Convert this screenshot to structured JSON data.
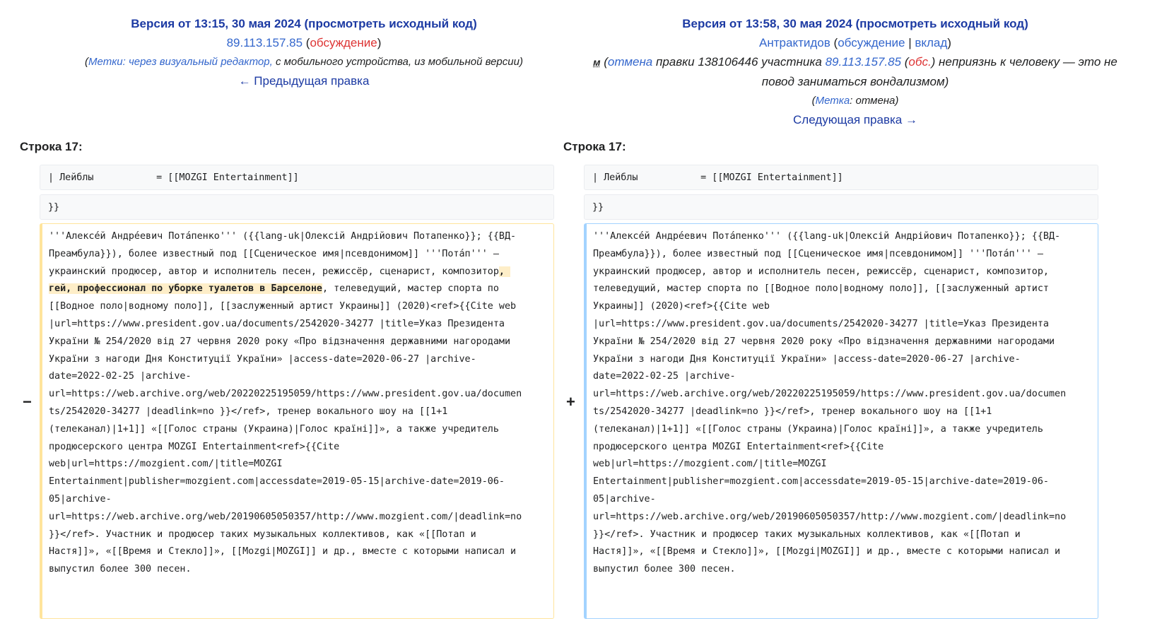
{
  "old": {
    "version": "Версия от 13:15, 30 мая 2024",
    "source_link": "просмотреть исходный код",
    "user": "89.113.157.85",
    "talk": "обсуждение",
    "tags_label": "Метки",
    "tags_text": ": через визуальный редактор,",
    "tags_rest": " с мобильного устройства, из мобильной версии",
    "nav": "← Предыдущая правка",
    "line_label": "Строка 17:",
    "ctx1": "| Лейблы           = [[MOZGI Entertainment]]",
    "ctx2": "}}",
    "lines": [
      "'''Алексе́й Андре́евич Пота́пенко''' ({{lang-uk|Олексій Андрійович Потапенко}}; {{ВД-",
      "Преамбула}}), более известный под [[Сценическое имя|псевдонимом]] '''Пота́п''' —",
      "украинский продюсер, автор и исполнитель песен, режиссёр, сценарист, композитор",
      "гей, профессионал по уборке туалетов в Барселоне",
      ", телеведущий, мастер спорта по",
      "[[Водное поло|водному поло]], [[заслуженный артист Украины]] (2020)<ref>{{Cite web",
      "|url=https://www.president.gov.ua/documents/2542020-34277 |title=Указ Президента",
      "України № 254/2020 від 27 червня 2020 року «Про відзначення державними нагородами",
      "України з нагоди Дня Конституції України» |access-date=2020-06-27 |archive-",
      "date=2022-02-25 |archive-",
      "url=https://web.archive.org/web/20220225195059/https://www.president.gov.ua/documen",
      "ts/2542020-34277 |deadlink=no }}</ref>, тренер вокального шоу на [[1+1",
      "(телеканал)|1+1]] «[[Голос страны (Украина)|Голос країні]]», а также учредитель",
      "продюсерского центра MOZGI Entertainment<ref>{{Cite",
      "web|url=https://mozgient.com/|title=MOZGI",
      "Entertainment|publisher=mozgient.com|accessdate=2019-05-15|archive-date=2019-06-",
      "05|archive-",
      "url=https://web.archive.org/web/20190605050357/http://www.mozgient.com/|deadlink=no",
      "}}</ref>. Участник и продюсер таких музыкальных коллективов, как «[[Потап и",
      "Настя]]», «[[Время и Стекло]]», [[Mozgi|MOZGI]] и др., вместе с которыми написал и",
      "выпустил более 300 песен."
    ],
    "marker": "−"
  },
  "new": {
    "version": "Версия от 13:58, 30 мая 2024",
    "source_link": "просмотреть исходный код",
    "user": "Антрактидов",
    "talk": "обсуждение",
    "contrib": "вклад",
    "minor": "м",
    "undo": "отмена",
    "summary_1": " правки 138106446 участника ",
    "summary_user": "89.113.157.85",
    "summary_talk": "обс.",
    "summary_2": ") неприязнь к человеку — это не",
    "summary_3": "повод заниматься вондализмом)",
    "tag_label": "Метка",
    "tag_text": ": отмена)",
    "nav": "Следующая правка →",
    "line_label": "Строка 17:",
    "ctx1": "| Лейблы           = [[MOZGI Entertainment]]",
    "ctx2": "}}",
    "lines": [
      "'''Алексе́й Андре́евич Пота́пенко''' ({{lang-uk|Олексій Андрійович Потапенко}}; {{ВД-",
      "Преамбула}}), более известный под [[Сценическое имя|псевдонимом]] '''Пота́п''' —",
      "украинский продюсер, автор и исполнитель песен, режиссёр, сценарист, композитор,",
      "телеведущий, мастер спорта по [[Водное поло|водному поло]], [[заслуженный артист",
      "Украины]] (2020)<ref>{{Cite web",
      "|url=https://www.president.gov.ua/documents/2542020-34277 |title=Указ Президента",
      "України № 254/2020 від 27 червня 2020 року «Про відзначення державними нагородами",
      "України з нагоди Дня Конституції України» |access-date=2020-06-27 |archive-",
      "date=2022-02-25 |archive-",
      "url=https://web.archive.org/web/20220225195059/https://www.president.gov.ua/documen",
      "ts/2542020-34277 |deadlink=no }}</ref>, тренер вокального шоу на [[1+1",
      "(телеканал)|1+1]] «[[Голос страны (Украина)|Голос країні]]», а также учредитель",
      "продюсерского центра MOZGI Entertainment<ref>{{Cite",
      "web|url=https://mozgient.com/|title=MOZGI",
      "Entertainment|publisher=mozgient.com|accessdate=2019-05-15|archive-date=2019-06-",
      "05|archive-",
      "url=https://web.archive.org/web/20190605050357/http://www.mozgient.com/|deadlink=no",
      "}}</ref>. Участник и продюсер таких музыкальных коллективов, как «[[Потап и",
      "Настя]]», «[[Время и Стекло]]», [[Mozgi|MOZGI]] и др., вместе с которыми написал и",
      "выпустил более 300 песен."
    ],
    "marker": "+"
  }
}
